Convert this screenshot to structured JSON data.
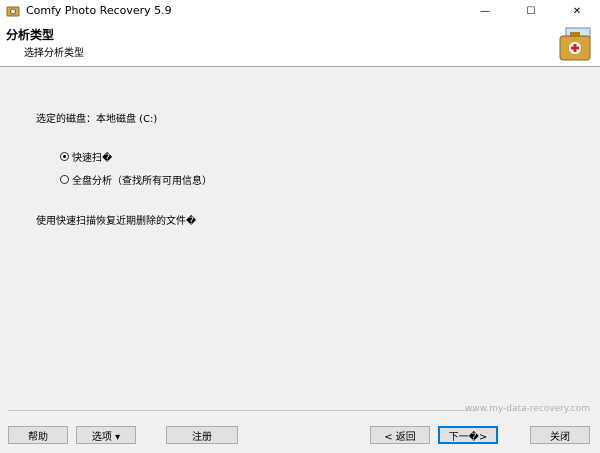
{
  "window": {
    "title": "Comfy Photo Recovery 5.9",
    "app_icon": "camera-icon"
  },
  "controls": {
    "minimize": "—",
    "maximize": "☐",
    "close": "✕"
  },
  "header": {
    "title": "分析类型",
    "subtitle": "选择分析类型",
    "icon": "first-aid-photo-icon"
  },
  "main": {
    "selected_drive": "选定的磁盘：本地磁盘 (C:)",
    "options": [
      {
        "label": "快速扫�",
        "checked": true
      },
      {
        "label": "全盘分析（查找所有可用信息）",
        "checked": false
      }
    ],
    "description": "使用快速扫描恢复近期删除的文件�"
  },
  "footer": {
    "watermark": "www.my-data-recovery.com",
    "help": "帮助",
    "options": "选项 ▾",
    "register": "注册",
    "back": "< 返回",
    "next": "下一�>",
    "close": "关闭"
  }
}
